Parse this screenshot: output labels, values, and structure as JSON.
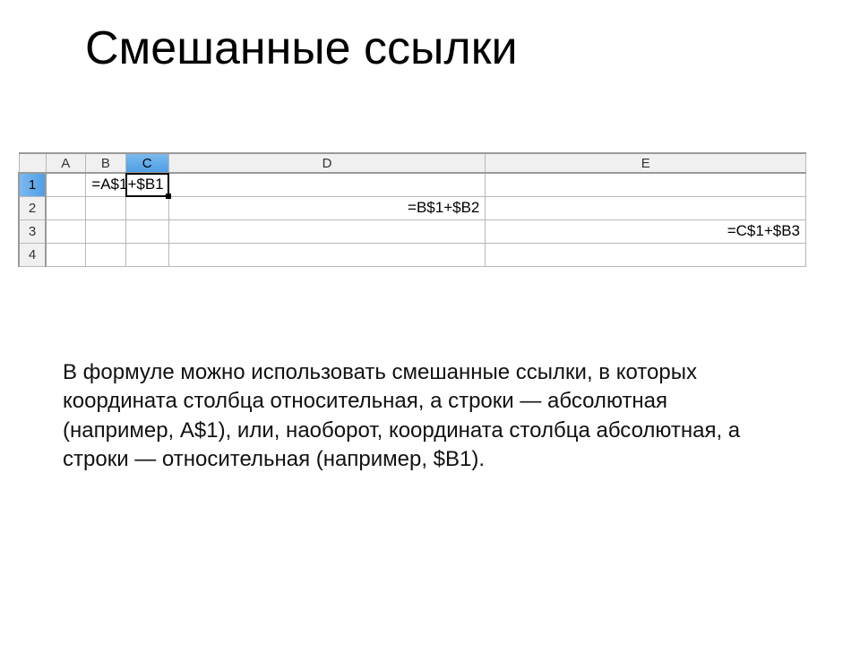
{
  "title": "Смешанные ссылки",
  "columns": [
    "A",
    "B",
    "C",
    "D",
    "E"
  ],
  "selected_col_index": 2,
  "rows": [
    "1",
    "2",
    "3",
    "4"
  ],
  "selected_row_index": 0,
  "cells": {
    "C1": "=A$1+$B1",
    "D2": "=B$1+$B2",
    "E3": "=C$1+$B3"
  },
  "active_cell": "C1",
  "paragraph": "В формуле можно использовать смешанные ссылки, в которых координата столбца относительная, а строки — абсолютная (например, A$1), или, наоборот, координата столбца абсолютная, а строки — относительная (например, $B1)."
}
